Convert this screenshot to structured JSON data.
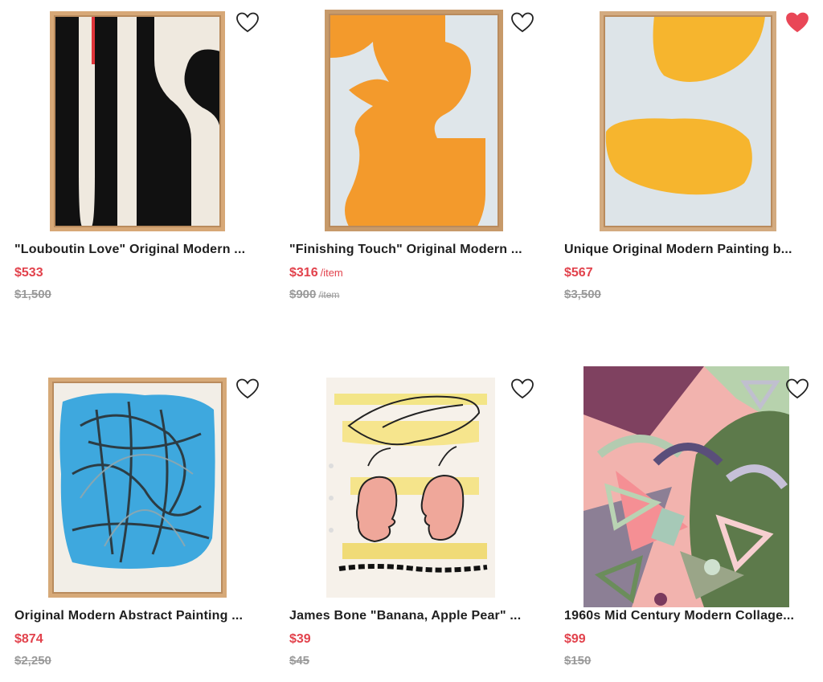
{
  "colors": {
    "price": "#e2424c",
    "strike": "#9a9a9a",
    "heart_filled": "#e94757",
    "heart_outline": "#222222"
  },
  "products": [
    {
      "title": "\"Louboutin Love\" Original Modern ...",
      "price": "$533",
      "price_unit": "",
      "original_price": "$1,500",
      "original_unit": "",
      "favorited": false,
      "heart_icon": "heart-outline-icon"
    },
    {
      "title": "\"Finishing Touch\" Original Modern ...",
      "price": "$316",
      "price_unit": "/item",
      "original_price": "$900",
      "original_unit": "/item",
      "favorited": false,
      "heart_icon": "heart-outline-icon"
    },
    {
      "title": "Unique Original Modern Painting b...",
      "price": "$567",
      "price_unit": "",
      "original_price": "$3,500",
      "original_unit": "",
      "favorited": true,
      "heart_icon": "heart-filled-icon"
    },
    {
      "title": "Original Modern Abstract Painting ...",
      "price": "$874",
      "price_unit": "",
      "original_price": "$2,250",
      "original_unit": "",
      "favorited": false,
      "heart_icon": "heart-outline-icon"
    },
    {
      "title": "James Bone \"Banana, Apple Pear\" ...",
      "price": "$39",
      "price_unit": "",
      "original_price": "$45",
      "original_unit": "",
      "favorited": false,
      "heart_icon": "heart-outline-icon"
    },
    {
      "title": "1960s Mid Century Modern Collage...",
      "price": "$99",
      "price_unit": "",
      "original_price": "$150",
      "original_unit": "",
      "favorited": false,
      "heart_icon": "heart-outline-icon"
    }
  ]
}
